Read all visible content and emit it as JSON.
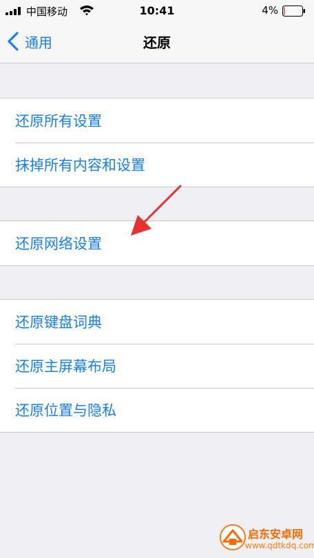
{
  "status_bar": {
    "carrier": "中国移动",
    "time": "10:41",
    "battery_percent": "4%",
    "battery_level": 0.04,
    "icons": [
      "signal-bars-icon",
      "wifi-icon",
      "battery-icon"
    ]
  },
  "nav": {
    "back_label": "通用",
    "title": "还原",
    "icons": [
      "chevron-left-icon"
    ]
  },
  "groups": [
    {
      "items": [
        {
          "label": "还原所有设置"
        },
        {
          "label": "抹掉所有内容和设置"
        }
      ]
    },
    {
      "items": [
        {
          "label": "还原网络设置"
        }
      ]
    },
    {
      "items": [
        {
          "label": "还原键盘词典"
        },
        {
          "label": "还原主屏幕布局"
        },
        {
          "label": "还原位置与隐私"
        }
      ]
    }
  ],
  "annotation": {
    "icon": "red-arrow-icon",
    "color": "#e8312f"
  },
  "watermark": {
    "name": "启东安卓网",
    "url": "www.qdtkdq.com",
    "icon": "site-logo-icon"
  },
  "colors": {
    "accent": "#157efb",
    "background": "#efeff4",
    "separator": "#c8c7cc",
    "battery_low": "#ff3b30"
  }
}
